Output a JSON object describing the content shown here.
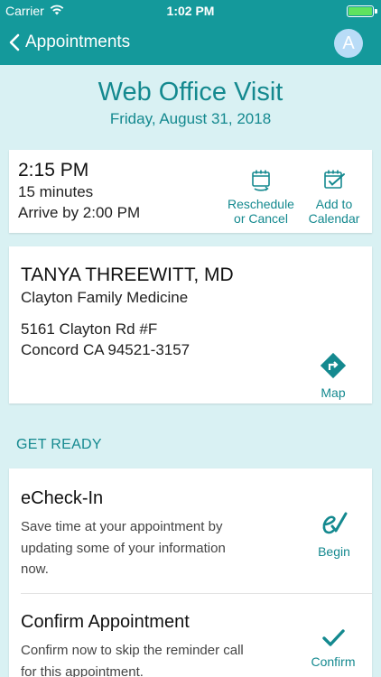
{
  "status": {
    "carrier": "Carrier",
    "time": "1:02 PM"
  },
  "nav": {
    "back_label": "Appointments",
    "avatar_initial": "A"
  },
  "visit": {
    "title": "Web Office Visit",
    "date": "Friday, August 31, 2018"
  },
  "appointment": {
    "time": "2:15 PM",
    "duration": "15 minutes",
    "arrive_by": "Arrive by 2:00 PM",
    "reschedule_line1": "Reschedule",
    "reschedule_line2": "or Cancel",
    "calendar_line1": "Add to",
    "calendar_line2": "Calendar"
  },
  "provider": {
    "name": "TANYA THREEWITT, MD",
    "practice": "Clayton Family Medicine",
    "address_line1": "5161 Clayton Rd #F",
    "address_line2": "Concord CA 94521-3157",
    "map_label": "Map"
  },
  "get_ready": {
    "section_label": "GET READY",
    "echeckin": {
      "title": "eCheck-In",
      "desc_line1": "Save time at your appointment by",
      "desc_line2": "updating some of your information",
      "desc_line3": "now.",
      "action_label": "Begin"
    },
    "confirm": {
      "title": "Confirm Appointment",
      "desc_line1": "Confirm now to skip the reminder call",
      "desc_line2": "for this appointment.",
      "action_label": "Confirm"
    }
  },
  "colors": {
    "accent": "#14999b",
    "accent_dark": "#14898f",
    "background": "#d9f1f3"
  }
}
